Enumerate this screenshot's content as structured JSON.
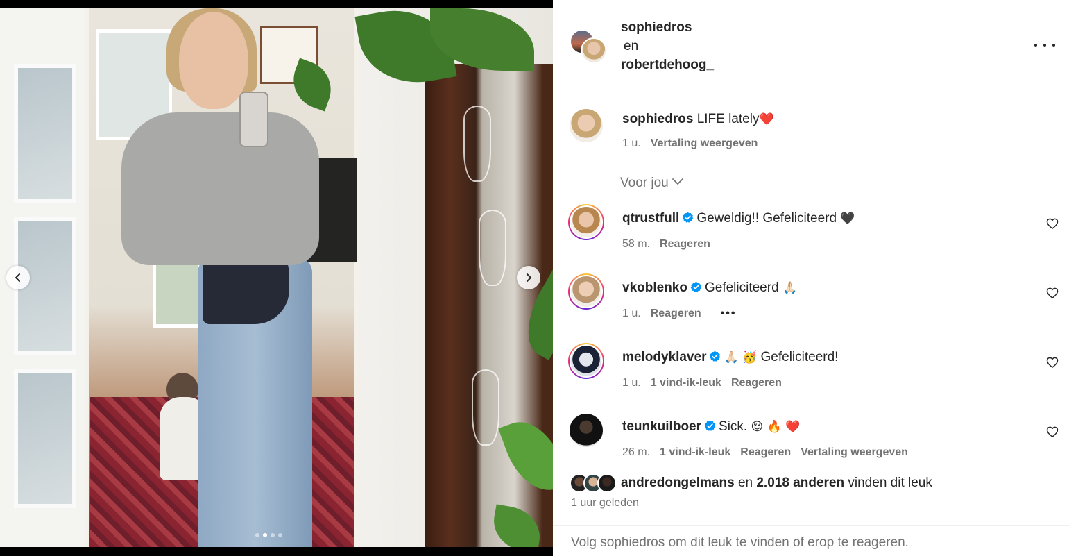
{
  "header": {
    "author1": "sophiedros",
    "joiner": "en",
    "author2": "robertdehoog_",
    "more_icon": "more-horizontal-icon"
  },
  "carousel": {
    "prev_icon": "chevron-left-icon",
    "next_icon": "chevron-right-icon",
    "slide_count": 4,
    "active_slide": 2
  },
  "caption": {
    "username": "sophiedros",
    "text": "LIFE lately",
    "emoji": "❤️",
    "time": "1 u.",
    "translate": "Vertaling weergeven"
  },
  "sort_label": "Voor jou",
  "comments": [
    {
      "username": "qtrustfull",
      "text": "Geweldig!! Gefeliciteerd",
      "emoji": "🖤",
      "time": "58 m.",
      "likes": "",
      "reply": "Reageren",
      "translate": "",
      "more": ""
    },
    {
      "username": "vkoblenko",
      "text": "Gefeliciteerd",
      "emoji": "🙏🏻",
      "time": "1 u.",
      "likes": "",
      "reply": "Reageren",
      "translate": "",
      "more": "•••"
    },
    {
      "username": "melodyklaver",
      "text": "Gefeliciteerd!",
      "emoji": "🙏🏻 🥳",
      "time": "1 u.",
      "likes": "1 vind-ik-leuk",
      "reply": "Reageren",
      "translate": "",
      "more": ""
    },
    {
      "username": "teunkuilboer",
      "text": "Sick.",
      "emoji": "😌 🔥 ❤️",
      "time": "26 m.",
      "likes": "1 vind-ik-leuk",
      "reply": "Reageren",
      "translate": "Vertaling weergeven",
      "more": ""
    }
  ],
  "likes": {
    "user": "andredongelmans",
    "joiner": "en",
    "count": "2.018 anderen",
    "suffix": "vinden dit leuk"
  },
  "posted": "1 uur geleden",
  "footer": "Volg sophiedros om dit leuk te vinden of erop te reageren.",
  "colors": {
    "text": "#262626",
    "secondary": "#737373",
    "verified": "#0095f6",
    "border": "#efefef"
  }
}
